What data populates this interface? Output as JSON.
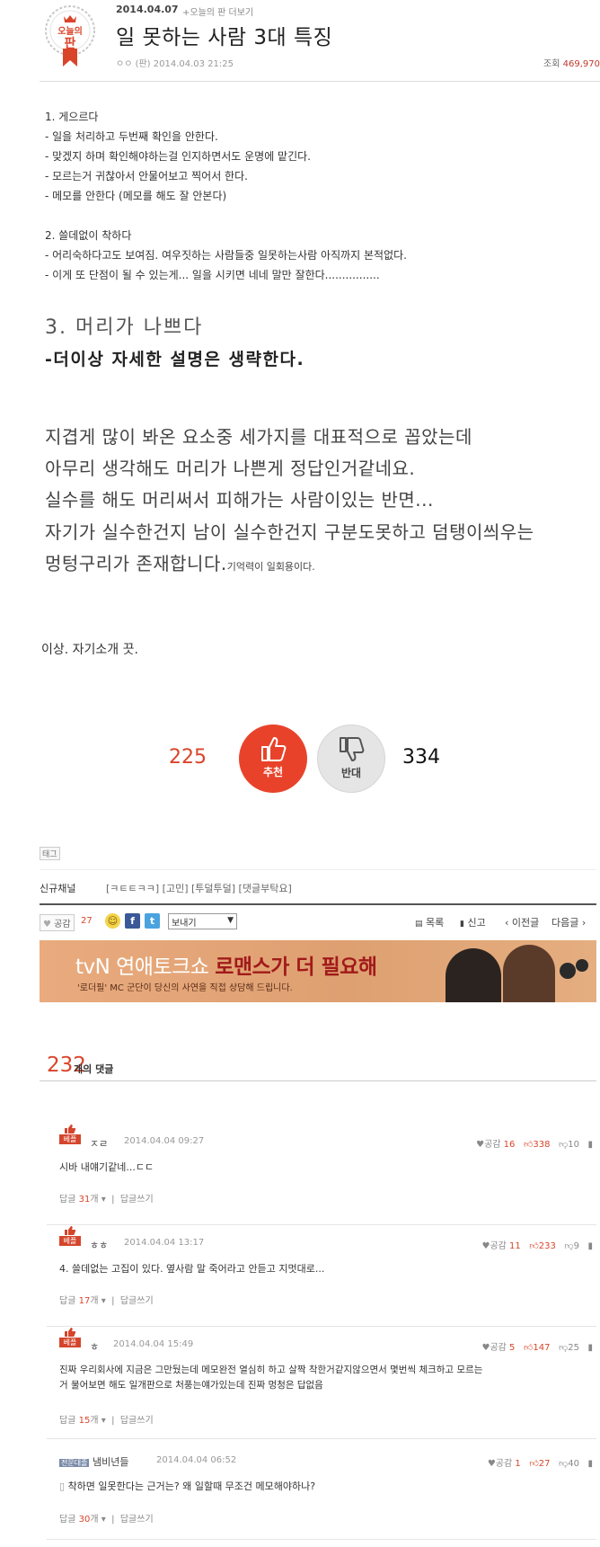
{
  "header": {
    "badge": {
      "line1": "오늘의",
      "line2": "판"
    },
    "date": "2014.04.07",
    "more": "+오늘의 판 더보기",
    "title": "일 못하는 사람 3대 특징",
    "meta": "ㅇㅇ (판)  2014.04.03 21:25",
    "views_label": "조회",
    "views": "469,970"
  },
  "body": {
    "s1_title": "1. 게으르다",
    "s1_lines": [
      "- 일을 처리하고 두번째 확인을 안한다.",
      "- 맞겠지 하며 확인해야하는걸 인지하면서도 운명에 맡긴다.",
      "- 모르는거 귀찮아서 안물어보고 찍어서 한다.",
      "- 메모를 안한다 (메모를 해도 잘 안본다)"
    ],
    "s2_title": "2. 쓸데없이 착하다",
    "s2_lines": [
      "- 어리숙하다고도 보여짐. 여우짓하는 사람들중 일못하는사람 아직까지 본적없다.",
      "- 이게 또 단점이 될 수 있는게... 일을 시키면 네네 말만 잘한다................"
    ],
    "s3_title": "3. 머리가 나쁘다",
    "s3_sub": "-더이상 자세한 설명은 생략한다.",
    "para": [
      "지겹게 많이 봐온 요소중 세가지를 대표적으로 꼽았는데",
      "아무리 생각해도 머리가 나쁜게 정답인거같네요.",
      "실수를 해도 머리써서 피해가는 사람이있는 반면...",
      "자기가 실수한건지 남이 실수한건지 구분도못하고 덤탱이씌우는",
      "멍텅구리가 존재합니다."
    ],
    "para_small": "기억력이 일회용이다.",
    "sign": "이상. 자기소개 끗."
  },
  "vote": {
    "up_count": "225",
    "up_label": "추천",
    "down_label": "반대",
    "down_count": "334"
  },
  "tags": {
    "label": "태그",
    "channel_label": "신규채널",
    "channels": "[ㅋㅌㅌㅋㅋ] [고민] [투덜투덜] [댓글부탁요]"
  },
  "toolbar": {
    "like_label": "공감",
    "like_count": "27",
    "share_select": "보내기",
    "list": "목록",
    "report": "신고",
    "prev": "‹ 이전글",
    "next": "다음글 ›"
  },
  "banner": {
    "title_pre": "tvN 연애토크쇼 ",
    "title_hl": "로맨스가 더 필요해",
    "sub": "'로더필' MC 군단이 당신의 사연을 직접 상담해 드립니다."
  },
  "comments_header": {
    "count": "232",
    "label": "개의 댓글"
  },
  "comments": [
    {
      "badge": "베플",
      "user": "ㅈㄹ",
      "date": "2014.04.04 09:27",
      "like_label": "공감",
      "like": "16",
      "up": "338",
      "down": "10",
      "text": [
        "시바 내얘기같네...ㄷㄷ"
      ],
      "reply_pre": "답글 ",
      "reply_count": "31",
      "reply_post": "개",
      "write": "답글쓰기"
    },
    {
      "badge": "베플",
      "user": "ㅎㅎ",
      "date": "2014.04.04 13:17",
      "like_label": "공감",
      "like": "11",
      "up": "233",
      "down": "9",
      "text": [
        "4. 쓸데없는 고집이 있다. 옆사람 말 죽어라고 안듣고 지멋대로..."
      ],
      "reply_pre": "답글 ",
      "reply_count": "17",
      "reply_post": "개",
      "write": "답글쓰기"
    },
    {
      "badge": "베플",
      "user": "ㅎ",
      "date": "2014.04.04 15:49",
      "like_label": "공감",
      "like": "5",
      "up": "147",
      "down": "25",
      "text": [
        "진짜 우리회사에 지금은 그만뒀는데 메모완전 열심히 하고 살짝 착한거같지않으면서 몇번씩 체크하고 모르는",
        "거 물어보면 해도 일개판으로 처풍는얘가있는데 진짜 멍청은 답없음"
      ],
      "reply_pre": "답글 ",
      "reply_count": "15",
      "reply_post": "개",
      "write": "답글쓰기"
    },
    {
      "badge": "전문대졸",
      "user": "냄비년들",
      "date": "2014.04.04 06:52",
      "like_label": "공감",
      "like": "1",
      "up": "27",
      "down": "40",
      "text": [
        "착하면 일못한다는 근거는? 왜 일할때 무조건 메모해야하나?"
      ],
      "reply_pre": "답글 ",
      "reply_count": "30",
      "reply_post": "개",
      "write": "답글쓰기"
    }
  ]
}
